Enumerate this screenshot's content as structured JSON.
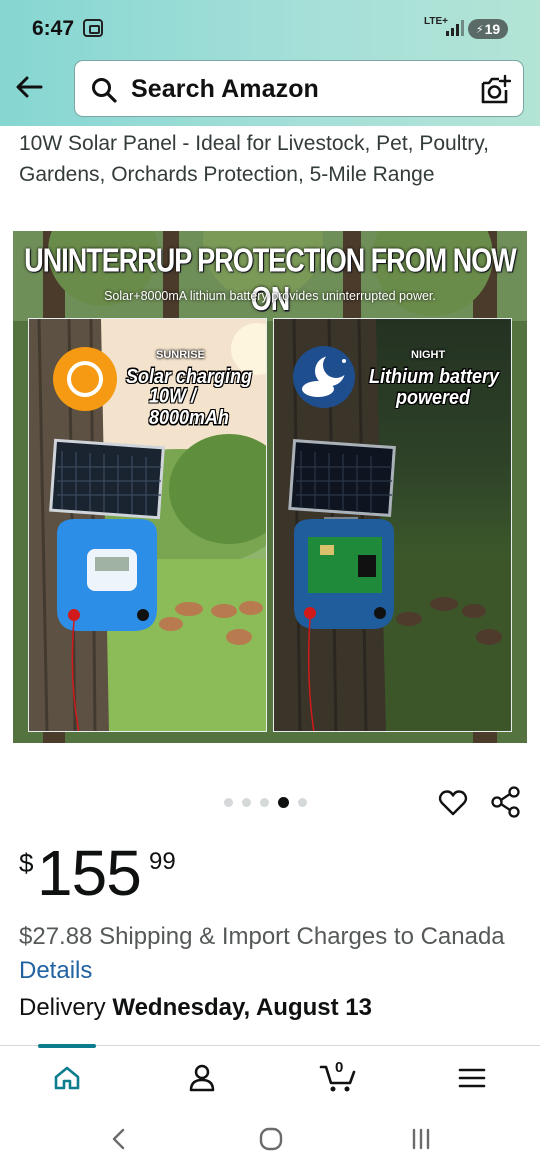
{
  "status_bar": {
    "time": "6:47",
    "network": "LTE+",
    "battery": "19"
  },
  "search": {
    "placeholder": "Search Amazon"
  },
  "product": {
    "title": "10W Solar Panel - Ideal for Livestock, Pet, Poultry, Gardens, Orchards Protection, 5-Mile Range",
    "image": {
      "headline": "UNINTERRUP PROTECTION FROM NOW ON",
      "subheadline": "Solar+8000mA lithium battery provides uninterrupted power.",
      "day_panel": {
        "small": "SUNRISE",
        "line1": "Solar charging",
        "line2": "10W / 8000mAh"
      },
      "night_panel": {
        "small": "NIGHT",
        "line1": "Lithium battery",
        "line2": "powered"
      }
    },
    "carousel": {
      "count": 5,
      "active_index": 3
    },
    "price": {
      "symbol": "$",
      "whole": "155",
      "fraction": "99"
    },
    "shipping": {
      "text": "$27.88 Shipping & Import Charges to Canada",
      "link": "Details"
    },
    "delivery": {
      "label": "Delivery",
      "date": "Wednesday, August 13"
    }
  },
  "bottom_nav": {
    "items": [
      "home-icon",
      "account-icon",
      "cart-icon",
      "menu-icon"
    ],
    "active": "home",
    "cart_count": "0"
  },
  "colors": {
    "header_teal": "#8fd8d3",
    "link": "#2162a1",
    "nav_active": "#0b7d8e"
  }
}
